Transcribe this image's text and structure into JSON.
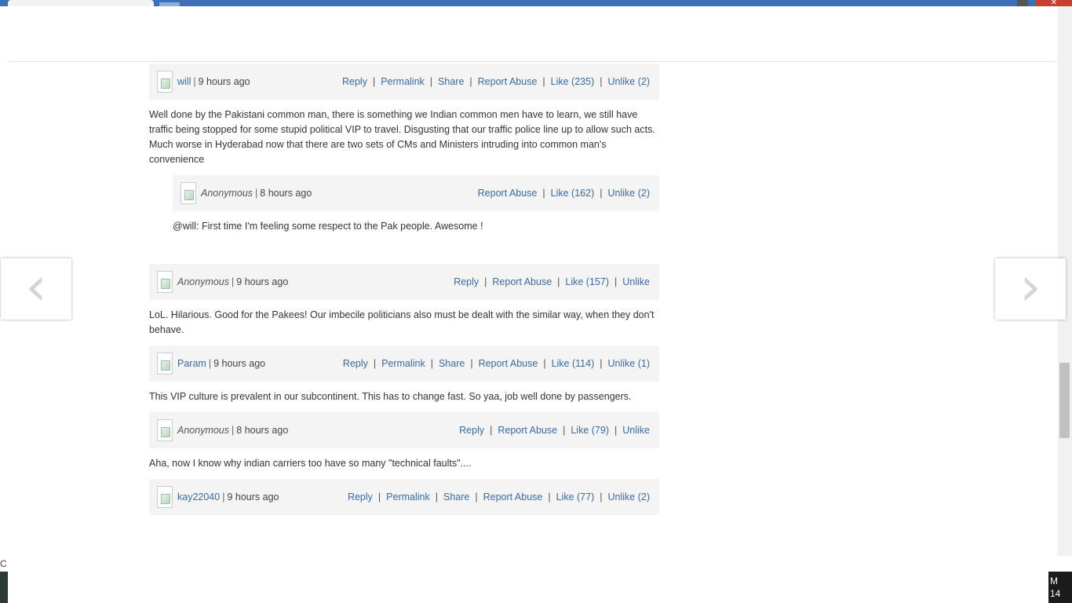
{
  "nav": {
    "prev_glyph": "‹",
    "next_glyph": "›"
  },
  "taskbar": {
    "left_text": "C",
    "clock_line1": "M",
    "clock_line2": "14"
  },
  "comments": [
    {
      "author": "will",
      "anonymous": false,
      "time": "9 hours ago",
      "actions": [
        "Reply",
        "Permalink",
        "Share",
        "Report Abuse",
        "Like (235)",
        "Unlike (2)"
      ],
      "text": "Well done by the Pakistani common man, there is something we Indian common men have to learn, we still have traffic being stopped for some stupid political VIP to travel. Disgusting that our traffic police line up to allow such acts. Much worse in Hyderabad now that there are two sets of CMs and Ministers intruding into common man's convenience"
    },
    {
      "author": "Anonymous",
      "anonymous": true,
      "time": "8 hours ago",
      "reply": true,
      "actions": [
        "Report Abuse",
        "Like (162)",
        "Unlike (2)"
      ],
      "text": "@will: First time I'm feeling some respect to the Pak people. Awesome !"
    },
    {
      "author": "Anonymous",
      "anonymous": true,
      "time": "9 hours ago",
      "actions": [
        "Reply",
        "Report Abuse",
        "Like (157)",
        "Unlike"
      ],
      "text": "LoL. Hilarious. Good for the Pakees! Our imbecile politicians also must be dealt with the similar way, when they don't behave."
    },
    {
      "author": "Param",
      "anonymous": false,
      "time": "9 hours ago",
      "actions": [
        "Reply",
        "Permalink",
        "Share",
        "Report Abuse",
        "Like (114)",
        "Unlike (1)"
      ],
      "text": "This VIP culture is prevalent in our subcontinent. This has to change fast. So yaa, job well done by passengers."
    },
    {
      "author": "Anonymous",
      "anonymous": true,
      "time": "8 hours ago",
      "actions": [
        "Reply",
        "Report Abuse",
        "Like (79)",
        "Unlike"
      ],
      "text": "Aha, now I know why indian carriers too have so many \"technical faults\"...."
    },
    {
      "author": "kay22040",
      "anonymous": false,
      "time": "9 hours ago",
      "actions": [
        "Reply",
        "Permalink",
        "Share",
        "Report Abuse",
        "Like (77)",
        "Unlike (2)"
      ],
      "text": ""
    }
  ]
}
